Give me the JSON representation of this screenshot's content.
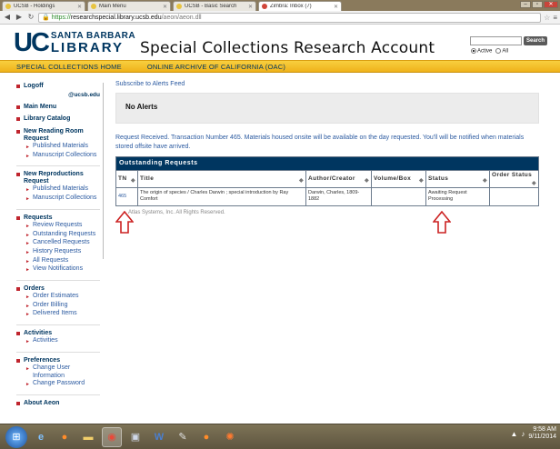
{
  "browser": {
    "tabs": [
      {
        "label": "UCSB - Holdings",
        "active": false
      },
      {
        "label": "Main Menu",
        "active": false
      },
      {
        "label": "UCSB - Basic Search",
        "active": false
      },
      {
        "label": "Zimbra: Inbox (7)",
        "active": true
      }
    ],
    "url_scheme": "https://",
    "url_host": "researchspecial.library.ucsb.edu",
    "url_path": "/aeon/aeon.dll"
  },
  "header": {
    "uc": "UC",
    "santa_barbara": "SANTA BARBARA",
    "library": "LIBRARY",
    "title": "Special Collections Research Account",
    "search_button": "Search",
    "radio_active": "Active",
    "radio_all": "All"
  },
  "goldbar": {
    "link1": "SPECIAL COLLECTIONS HOME",
    "link2": "ONLINE ARCHIVE OF CALIFORNIA (OAC)"
  },
  "sidebar": {
    "logoff": "Logoff",
    "user": "@ucsb.edu",
    "main_menu": "Main Menu",
    "library_catalog": "Library Catalog",
    "new_reading_room": "New Reading Room Request",
    "nrr_items": [
      "Published Materials",
      "Manuscript Collections"
    ],
    "new_reproductions": "New Reproductions Request",
    "nrp_items": [
      "Published Materials",
      "Manuscript Collections"
    ],
    "requests": "Requests",
    "requests_items": [
      "Review Requests",
      "Outstanding Requests",
      "Cancelled Requests",
      "History Requests",
      "All Requests",
      "View Notifications"
    ],
    "orders": "Orders",
    "orders_items": [
      "Order Estimates",
      "Order Billing",
      "Delivered Items"
    ],
    "activities": "Activities",
    "activities_items": [
      "Activities"
    ],
    "preferences": "Preferences",
    "preferences_items": [
      "Change User Information",
      "Change Password"
    ],
    "about": "About Aeon"
  },
  "main": {
    "subscribe": "Subscribe to Alerts Feed",
    "no_alerts": "No Alerts",
    "message": "Request Received. Transaction Number 465. Materials housed onsite will be available on the day requested. You'll will be notified when materials stored offsite have arrived.",
    "table_caption": "Outstanding Requests",
    "columns": [
      "TN",
      "Title",
      "Author/Creator",
      "Volume/Box",
      "Status",
      "Order Status"
    ],
    "rows": [
      {
        "tn": "465",
        "title": "The origin of species / Charles Darwin ; special introduction by Ray Comfort",
        "author": "Darwin, Charles, 1809-1882",
        "volume": "",
        "status": "Awaiting Request Processing",
        "order_status": ""
      }
    ],
    "copyright": "Atlas Systems, Inc. All Rights Reserved.",
    "arrow_color": "#cc2222"
  },
  "taskbar": {
    "time": "9:58 AM",
    "date": "9/11/2014"
  },
  "colors": {
    "brand_navy": "#003660",
    "gold": "#f2bb24",
    "link_blue": "#2b5aa0",
    "bullet_red": "#c0252e"
  }
}
